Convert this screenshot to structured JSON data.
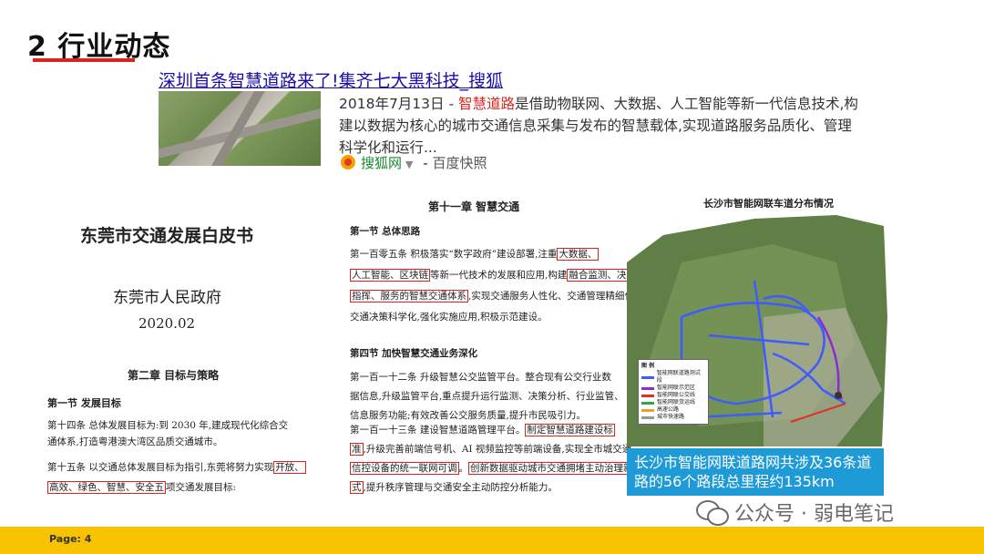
{
  "slide": {
    "title": "2 行业动态",
    "page_label": "Page: 4"
  },
  "news": {
    "headline": "深圳首条智慧道路来了!集齐七大黑科技_搜狐",
    "snippet_date": "2018年7月13日 - ",
    "snippet_highlight": "智慧道路",
    "snippet_rest": "是借助物联网、大数据、人工智能等新一代信息技术,构建以数据为核心的城市交通信息采集与发布的智慧载体,实现道路服务品质化、管理科学化和运行...",
    "source_name": "搜狐网",
    "source_arrow": "▼",
    "source_sep": " - ",
    "source_cache": "百度快照"
  },
  "left_doc": {
    "title": "东莞市交通发展白皮书",
    "gov": "东莞市人民政府",
    "date": "2020.02",
    "chapter": "第二章 目标与策略",
    "section": "第一节 发展目标",
    "p1_line1": "第十四条    总体发展目标为:到 2030 年,建成现代化综合交",
    "p1_line2": "通体系,打造粤港澳大湾区品质交通城市。",
    "p2_line1_a": "第十五条    以交通总体发展目标为指引,东莞将努力实现",
    "p2_line1_box": "开放、",
    "p2_line2_box": "高效、绿色、智慧、安全五",
    "p2_line2_b": "项交通发展目标:"
  },
  "mid_doc": {
    "chapter": "第十一章  智慧交通",
    "sec1": "第一节 总体思路",
    "p1_l1_a": "第一百零五条  积极落实“数字政府”建设部署,注重",
    "p1_l1_box": "大数据、",
    "p1_l2_box": "人工智能、区块链",
    "p1_l2_b": "等新一代技术的发展和应用,构建",
    "p1_l2_box2": "融合监测、决策、",
    "p1_l3_box": "指挥、服务的智慧交通体系",
    "p1_l3_b": ",实现交通服务人性化、交通管理精细化、",
    "p1_l4": "交通决策科学化,强化实施应用,积极示范建设。",
    "sec4": "第四节 加快智慧交通业务深化",
    "p2_l1": "第一百一十二条  升级智慧公交监管平台。整合现有公交行业数",
    "p2_l2": "据信息,升级监管平台,重点提升运行监测、决策分析、行业监管、",
    "p2_l3": "信息服务功能;有效改善公交服务质量,提升市民吸引力。",
    "p3_l1_a": "第一百一十三条  建设智慧道路管理平台。",
    "p3_l1_box": "制定智慧道路建设标",
    "p3_l2_box": "准",
    "p3_l2_b": ",升级完善前端信号机、AI 视频监控等前端设备,实现全市城交通",
    "p3_l3_box": "信控设备的统一联网可调",
    "p3_l3_b": "。",
    "p3_l3_box2": "创新数据驱动城市交通拥堵主动治理新模",
    "p3_l4_box": "式",
    "p3_l4_b": ",提升秩序管理与交通安全主动防控分析能力。"
  },
  "map": {
    "title": "长沙市智能网联车道分布情况",
    "legend_title": "图 例",
    "legend_items": [
      "智能网联道路测试段",
      "智能网联示范区",
      "智能网联公交线",
      "智能网联货运线",
      "高速公路",
      "城市快速路"
    ],
    "caption": "长沙市智能网联道路网共涉及36条道路的56个路段总里程约135km",
    "colors": {
      "road_blue": "#3d5bff",
      "road_purple": "#8a2bd6",
      "road_red": "#e0301e",
      "caption_bg": "#1e9bd7"
    }
  },
  "watermark": {
    "text": "公众号 · 弱电笔记"
  },
  "colors": {
    "accent_red": "#d9261c",
    "footer_yellow": "#f7c200",
    "link_blue": "#1a0dab"
  }
}
